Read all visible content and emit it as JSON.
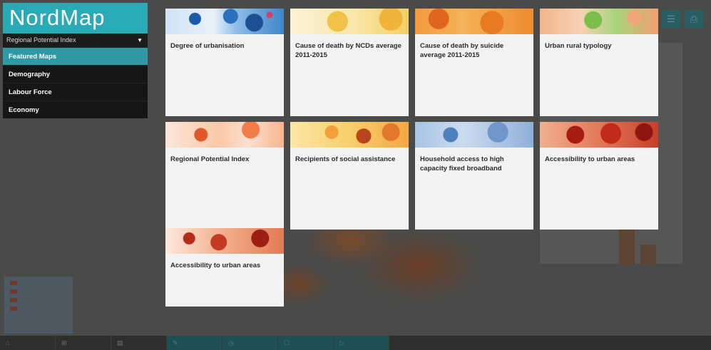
{
  "app": {
    "logo": "NordMap"
  },
  "indicator_select": {
    "value": "Regional Potential Index"
  },
  "menu": [
    {
      "label": "Featured Maps",
      "active": true
    },
    {
      "label": "Demography",
      "active": false
    },
    {
      "label": "Labour Force",
      "active": false
    },
    {
      "label": "Economy",
      "active": false
    }
  ],
  "cards": [
    {
      "title": "Degree of urbanisation",
      "theme": "blue"
    },
    {
      "title": "Cause of death by NCDs average 2011-2015",
      "theme": "yellow"
    },
    {
      "title": "Cause of death by suicide average 2011-2015",
      "theme": "orange"
    },
    {
      "title": "Urban rural typology",
      "theme": "green"
    },
    {
      "title": "Regional Potential Index",
      "theme": "peach"
    },
    {
      "title": "Recipients of social assistance",
      "theme": "gold"
    },
    {
      "title": "Household access to high capacity fixed broadband",
      "theme": "steel"
    },
    {
      "title": "Accessibility to urban areas",
      "theme": "red"
    },
    {
      "title": "Accessibility to urban areas",
      "theme": "red"
    }
  ],
  "colors": {
    "brand": "#29aab5",
    "menu_active": "#2f9aa6",
    "menu_bg": "#161616",
    "card_bg": "#f3f3f3"
  }
}
